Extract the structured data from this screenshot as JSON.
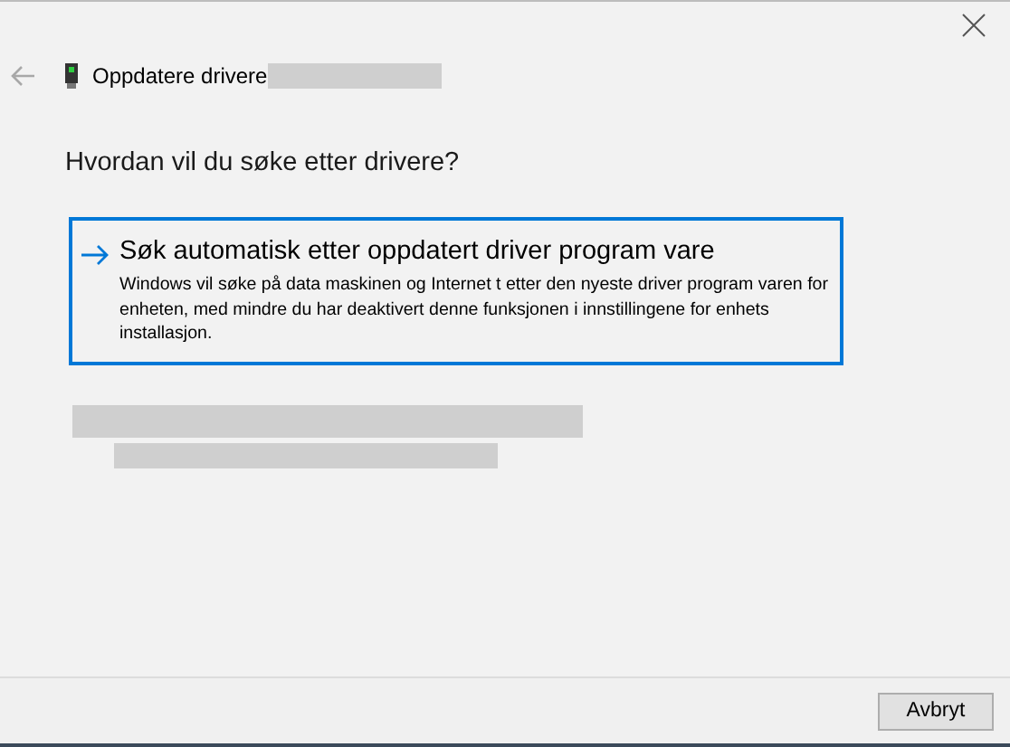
{
  "window": {
    "title": "Oppdatere drivere"
  },
  "question": "Hvordan vil du søke etter drivere?",
  "options": [
    {
      "title": "Søk automatisk etter oppdatert driver program vare",
      "description": "Windows vil søke på data maskinen og Internet t etter den nyeste driver program varen for enheten, med mindre du har deaktivert denne funksjonen i innstillingene for enhets installasjon.",
      "selected": true
    }
  ],
  "buttons": [
    "Avbryt"
  ]
}
